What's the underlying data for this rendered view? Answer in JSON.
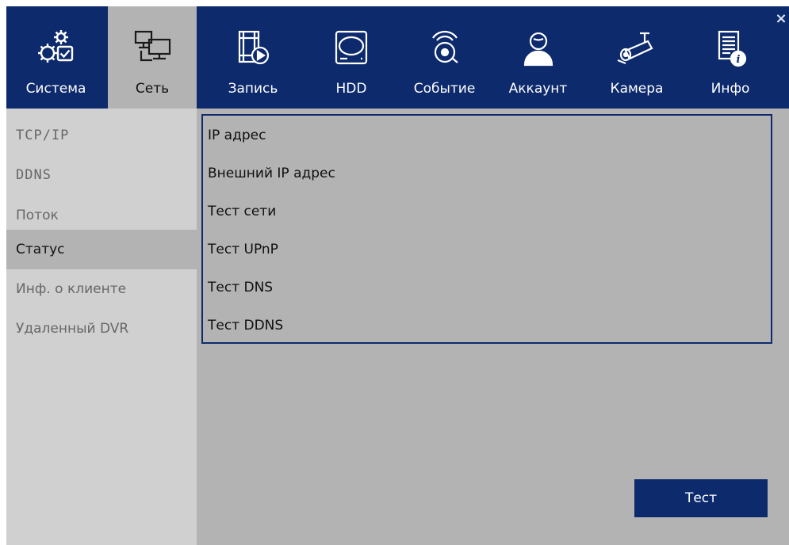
{
  "window": {
    "close_glyph": "×",
    "close_icon": "close-icon"
  },
  "tabs": [
    {
      "label": "Система",
      "icon": "system-gears-icon",
      "active": false
    },
    {
      "label": "Сеть",
      "icon": "network-computers-icon",
      "active": true
    },
    {
      "label": "Запись",
      "icon": "record-film-icon",
      "active": false
    },
    {
      "label": "HDD",
      "icon": "hdd-icon",
      "active": false
    },
    {
      "label": "Событие",
      "icon": "event-alarm-icon",
      "active": false
    },
    {
      "label": "Аккаунт",
      "icon": "account-user-icon",
      "active": false
    },
    {
      "label": "Камера",
      "icon": "camera-icon",
      "active": false
    },
    {
      "label": "Инфо",
      "icon": "info-document-icon",
      "active": false
    }
  ],
  "sidebar": {
    "items": [
      {
        "label": "TCP/IP",
        "active": false
      },
      {
        "label": "DDNS",
        "active": false
      },
      {
        "label": "Поток",
        "active": false
      },
      {
        "label": "Статус",
        "active": true
      },
      {
        "label": "Инф. о клиенте",
        "active": false
      },
      {
        "label": "Удаленный DVR",
        "active": false
      }
    ]
  },
  "status": {
    "rows": [
      {
        "label": "IP адрес"
      },
      {
        "label": "Внешний IP адрес"
      },
      {
        "label": "Тест сети"
      },
      {
        "label": "Тест UPnP"
      },
      {
        "label": "Тест DNS"
      },
      {
        "label": "Тест DDNS"
      }
    ]
  },
  "actions": {
    "test_label": "Тест"
  },
  "colors": {
    "header_bg": "#0d2a6d",
    "panel_bg": "#b3b3b3",
    "sidebar_bg": "#d0d0d0",
    "active_item_bg": "#b3b3b3",
    "accent": "#0d2a6d"
  }
}
